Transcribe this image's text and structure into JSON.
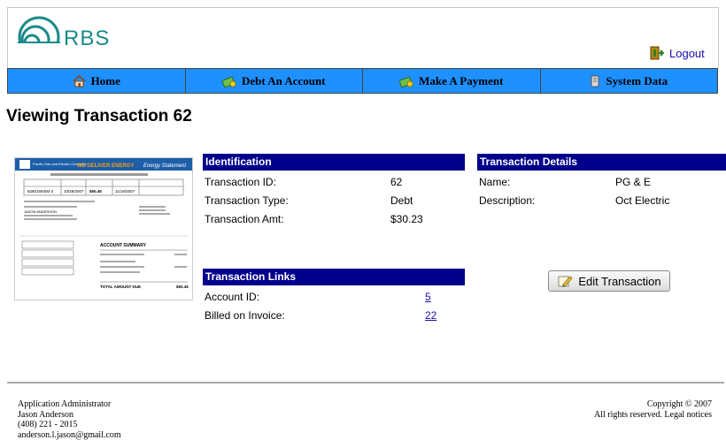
{
  "header": {
    "logo_text": "RBS",
    "logout_label": "Logout"
  },
  "nav": {
    "items": [
      {
        "label": "Home",
        "icon": "home-icon"
      },
      {
        "label": "Debt An Account",
        "icon": "money-icon"
      },
      {
        "label": "Make A Payment",
        "icon": "money-icon"
      },
      {
        "label": "System Data",
        "icon": "server-icon"
      }
    ]
  },
  "page_title": "Viewing Transaction 62",
  "identification": {
    "heading": "Identification",
    "rows": [
      {
        "label": "Transaction ID:",
        "value": "62"
      },
      {
        "label": "Transaction Type:",
        "value": "Debt"
      },
      {
        "label": "Transaction Amt:",
        "value": "$30.23"
      }
    ]
  },
  "transaction_links": {
    "heading": "Transaction Links",
    "rows": [
      {
        "label": "Account ID:",
        "value": "5"
      },
      {
        "label": "Billed on Invoice:",
        "value": "22"
      }
    ]
  },
  "transaction_details": {
    "heading": "Transaction Details",
    "rows": [
      {
        "label": "Name:",
        "value": "PG & E"
      },
      {
        "label": "Description:",
        "value": "Oct Electric"
      }
    ]
  },
  "edit_button_label": "Edit Transaction",
  "invoice_thumb": {
    "company": "Pacific Gas and Electric Company",
    "banner": "WE DELIVER ENERGY",
    "statement": "Energy Statement",
    "account_number": "8280155400-3",
    "bill_date": "10/28/2007",
    "amount_due": "$60.45",
    "due_date": "11/19/2007",
    "customer": "JASON ANDERSON",
    "summary_title": "ACCOUNT SUMMARY",
    "total_label": "TOTAL AMOUNT DUE",
    "total_value": "$60.45"
  },
  "footer": {
    "left_lines": [
      "Application Administrator",
      "Jason Anderson",
      "(408) 221 - 2015",
      "anderson.l.jason@gmail.com"
    ],
    "right_lines": [
      "Copyright © 2007",
      "All rights reserved. Legal notices"
    ]
  },
  "colors": {
    "nav_bg": "#1e90ff",
    "section_header_bg": "#00008b",
    "logo_teal": "#1a8a88"
  }
}
